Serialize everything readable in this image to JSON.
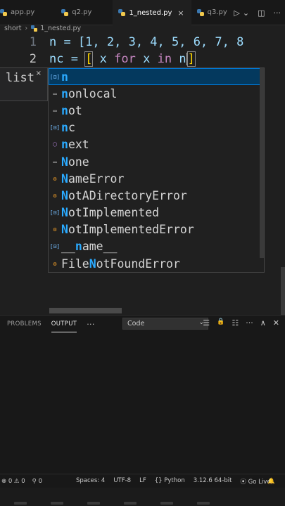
{
  "tabs": [
    {
      "label": "app.py",
      "active": false
    },
    {
      "label": "q2.py",
      "active": false
    },
    {
      "label": "1_nested.py",
      "active": true
    },
    {
      "label": "q3.py",
      "active": false
    }
  ],
  "tab_close": "×",
  "tab_actions": {
    "run": "▷",
    "run_menu": "⌄",
    "split": "◫",
    "more": "···"
  },
  "breadcrumb": {
    "folder": "short",
    "sep": "›",
    "file": "1_nested.py"
  },
  "editor": {
    "line1": {
      "num": "1",
      "text": "n = [1, 2, 3, 4, 5, 6, 7, 8"
    },
    "line2": {
      "num": "2",
      "prefix": "nc = ",
      "bracket": "[",
      "expr_x": " x ",
      "kw_for": "for",
      "expr_x2": " x ",
      "kw_in": "in",
      "tail": " n",
      "close": "]"
    }
  },
  "hover": {
    "text": "list",
    "close": "×"
  },
  "suggest": {
    "items": [
      {
        "prefix": "",
        "match": "n",
        "rest": "",
        "icon": "variable-icon",
        "glyph": "[⊡]"
      },
      {
        "prefix": "",
        "match": "n",
        "rest": "onlocal",
        "icon": "keyword-icon",
        "glyph": "▭"
      },
      {
        "prefix": "",
        "match": "n",
        "rest": "ot",
        "icon": "keyword-icon",
        "glyph": "▭"
      },
      {
        "prefix": "",
        "match": "n",
        "rest": "c",
        "icon": "variable-icon",
        "glyph": "[⊡]"
      },
      {
        "prefix": "",
        "match": "n",
        "rest": "ext",
        "icon": "function-icon",
        "glyph": "⬡"
      },
      {
        "prefix": "",
        "match": "N",
        "rest": "one",
        "icon": "keyword-icon",
        "glyph": "▭"
      },
      {
        "prefix": "",
        "match": "N",
        "rest": "ameError",
        "icon": "class-icon",
        "glyph": "⚙"
      },
      {
        "prefix": "",
        "match": "N",
        "rest": "otADirectoryError",
        "icon": "class-icon",
        "glyph": "⚙"
      },
      {
        "prefix": "",
        "match": "N",
        "rest": "otImplemented",
        "icon": "variable-icon",
        "glyph": "[⊡]"
      },
      {
        "prefix": "",
        "match": "N",
        "rest": "otImplementedError",
        "icon": "class-icon",
        "glyph": "⚙"
      },
      {
        "prefix": "__",
        "match": "n",
        "rest": "ame__",
        "icon": "variable-icon",
        "glyph": "[⊡]"
      },
      {
        "prefix": "File",
        "match": "N",
        "rest": "otFoundError",
        "icon": "class-icon",
        "glyph": "⚙"
      }
    ]
  },
  "panel": {
    "tabs": [
      {
        "label": "PROBLEMS",
        "active": false
      },
      {
        "label": "OUTPUT",
        "active": true
      }
    ],
    "more": "···",
    "channel": "Code",
    "actions": {
      "list": "☰",
      "lock": "🔒",
      "clear": "☷",
      "more": "···",
      "maximize": "∧",
      "close": "✕"
    }
  },
  "status": {
    "errors": "⊗ 0 ⚠ 0",
    "ports": "⚲ 0",
    "spaces": "Spaces: 4",
    "encoding": "UTF-8",
    "eol": "LF",
    "language": "{} Python",
    "interpreter": "3.12.6 64-bit",
    "golive": "⦿ Go Live",
    "notifications": "🔔"
  },
  "colors": {
    "accent": "#0078d4",
    "selected_bg": "#04395e",
    "match": "#2aaaff",
    "number": "#b5cea8",
    "variable": "#9cdcfe",
    "keyword": "#c586c0",
    "bracket": "#ffd700"
  }
}
